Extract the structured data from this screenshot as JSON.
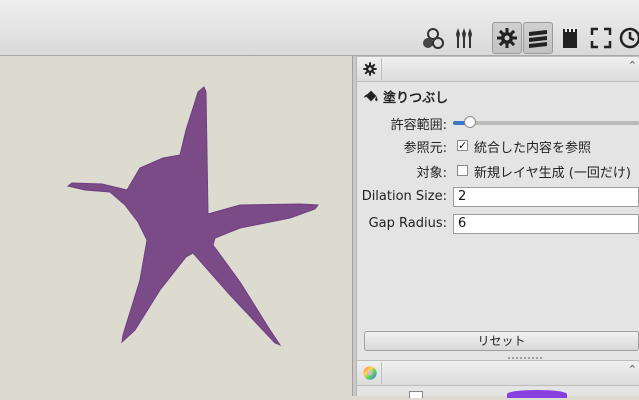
{
  "panel": {
    "title": "塗りつぶし",
    "tolerance_label": "許容範囲:",
    "tolerance_fraction": 0.09,
    "source_label": "参照元:",
    "source_checkbox_label": "統合した内容を参照",
    "source_checked": true,
    "target_label": "対象:",
    "target_checkbox_label": "新規レイヤ生成 (一回だけ)",
    "target_checked": false,
    "dilation_label": "Dilation Size:",
    "dilation_value": "2",
    "gap_label": "Gap Radius:",
    "gap_value": "6",
    "reset_label": "リセット"
  },
  "colors": {
    "star": "#7a4b86",
    "canvas": "#dddad0",
    "slider_fill": "#3a76c8"
  },
  "icons": {
    "toolbar": [
      "brush-presets-icon",
      "brushes-icon",
      "tool-options-icon",
      "layers-icon",
      "scratchpad-icon",
      "fullscreen-icon",
      "history-icon"
    ],
    "panel_tab": "gear-icon",
    "tool": "fill-bucket-icon",
    "second_panel_tab": "color-wheel-icon"
  }
}
